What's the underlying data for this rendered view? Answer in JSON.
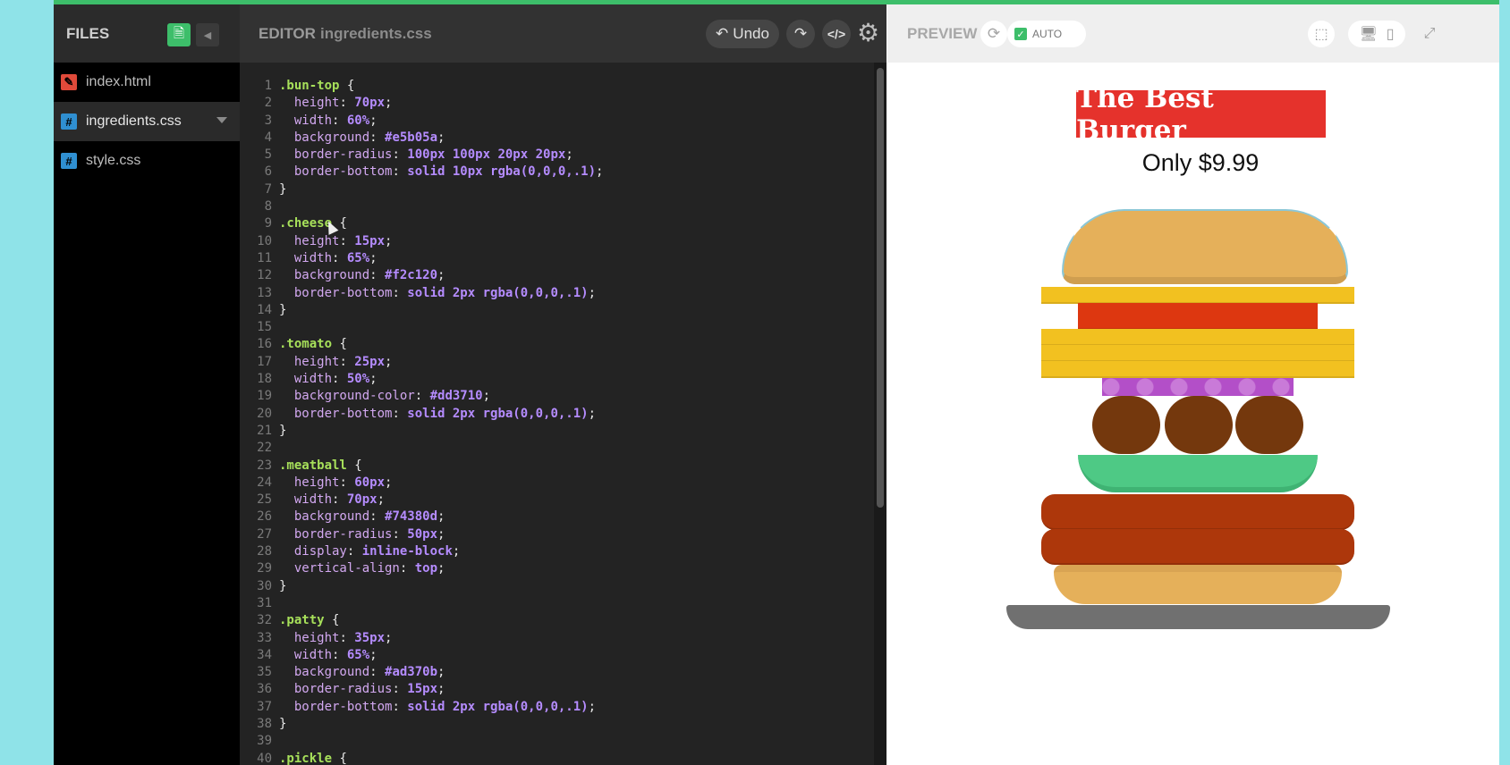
{
  "sidebar": {
    "title": "FILES",
    "files": [
      {
        "name": "index.html",
        "type": "html",
        "icon": "pencil-icon"
      },
      {
        "name": "ingredients.css",
        "type": "css",
        "icon": "hash-icon"
      },
      {
        "name": "style.css",
        "type": "css",
        "icon": "hash-icon"
      }
    ],
    "active_file": "ingredients.css"
  },
  "editor": {
    "title": "EDITOR",
    "filename": "ingredients.css",
    "undo_label": "Undo",
    "lines": [
      ".bun-top {",
      "  height: 70px;",
      "  width: 60%;",
      "  background: #e5b05a;",
      "  border-radius: 100px 100px 20px 20px;",
      "  border-bottom: solid 10px rgba(0,0,0,.1);",
      "}",
      "",
      ".cheese {",
      "  height: 15px;",
      "  width: 65%;",
      "  background: #f2c120;",
      "  border-bottom: solid 2px rgba(0,0,0,.1);",
      "}",
      "",
      ".tomato {",
      "  height: 25px;",
      "  width: 50%;",
      "  background-color: #dd3710;",
      "  border-bottom: solid 2px rgba(0,0,0,.1);",
      "}",
      "",
      ".meatball {",
      "  height: 60px;",
      "  width: 70px;",
      "  background: #74380d;",
      "  border-radius: 50px;",
      "  display: inline-block;",
      "  vertical-align: top;",
      "}",
      "",
      ".patty {",
      "  height: 35px;",
      "  width: 65%;",
      "  background: #ad370b;",
      "  border-radius: 15px;",
      "  border-bottom: solid 2px rgba(0,0,0,.1);",
      "}",
      "",
      ".pickle {"
    ]
  },
  "preview": {
    "title": "PREVIEW",
    "auto_label": "AUTO",
    "auto_checked": true,
    "burger_title": "The Best Burger",
    "burger_price": "Only $9.99",
    "colors": {
      "bun": "#e5b05a",
      "cheese": "#f2c120",
      "tomato": "#dd3710",
      "meatball": "#74380d",
      "patty": "#ad370b",
      "lettuce": "#4ec985",
      "onion": "#b34fc8",
      "plate": "#707070",
      "title_bg": "#e5322c"
    }
  },
  "accent": "#3dbe6a"
}
